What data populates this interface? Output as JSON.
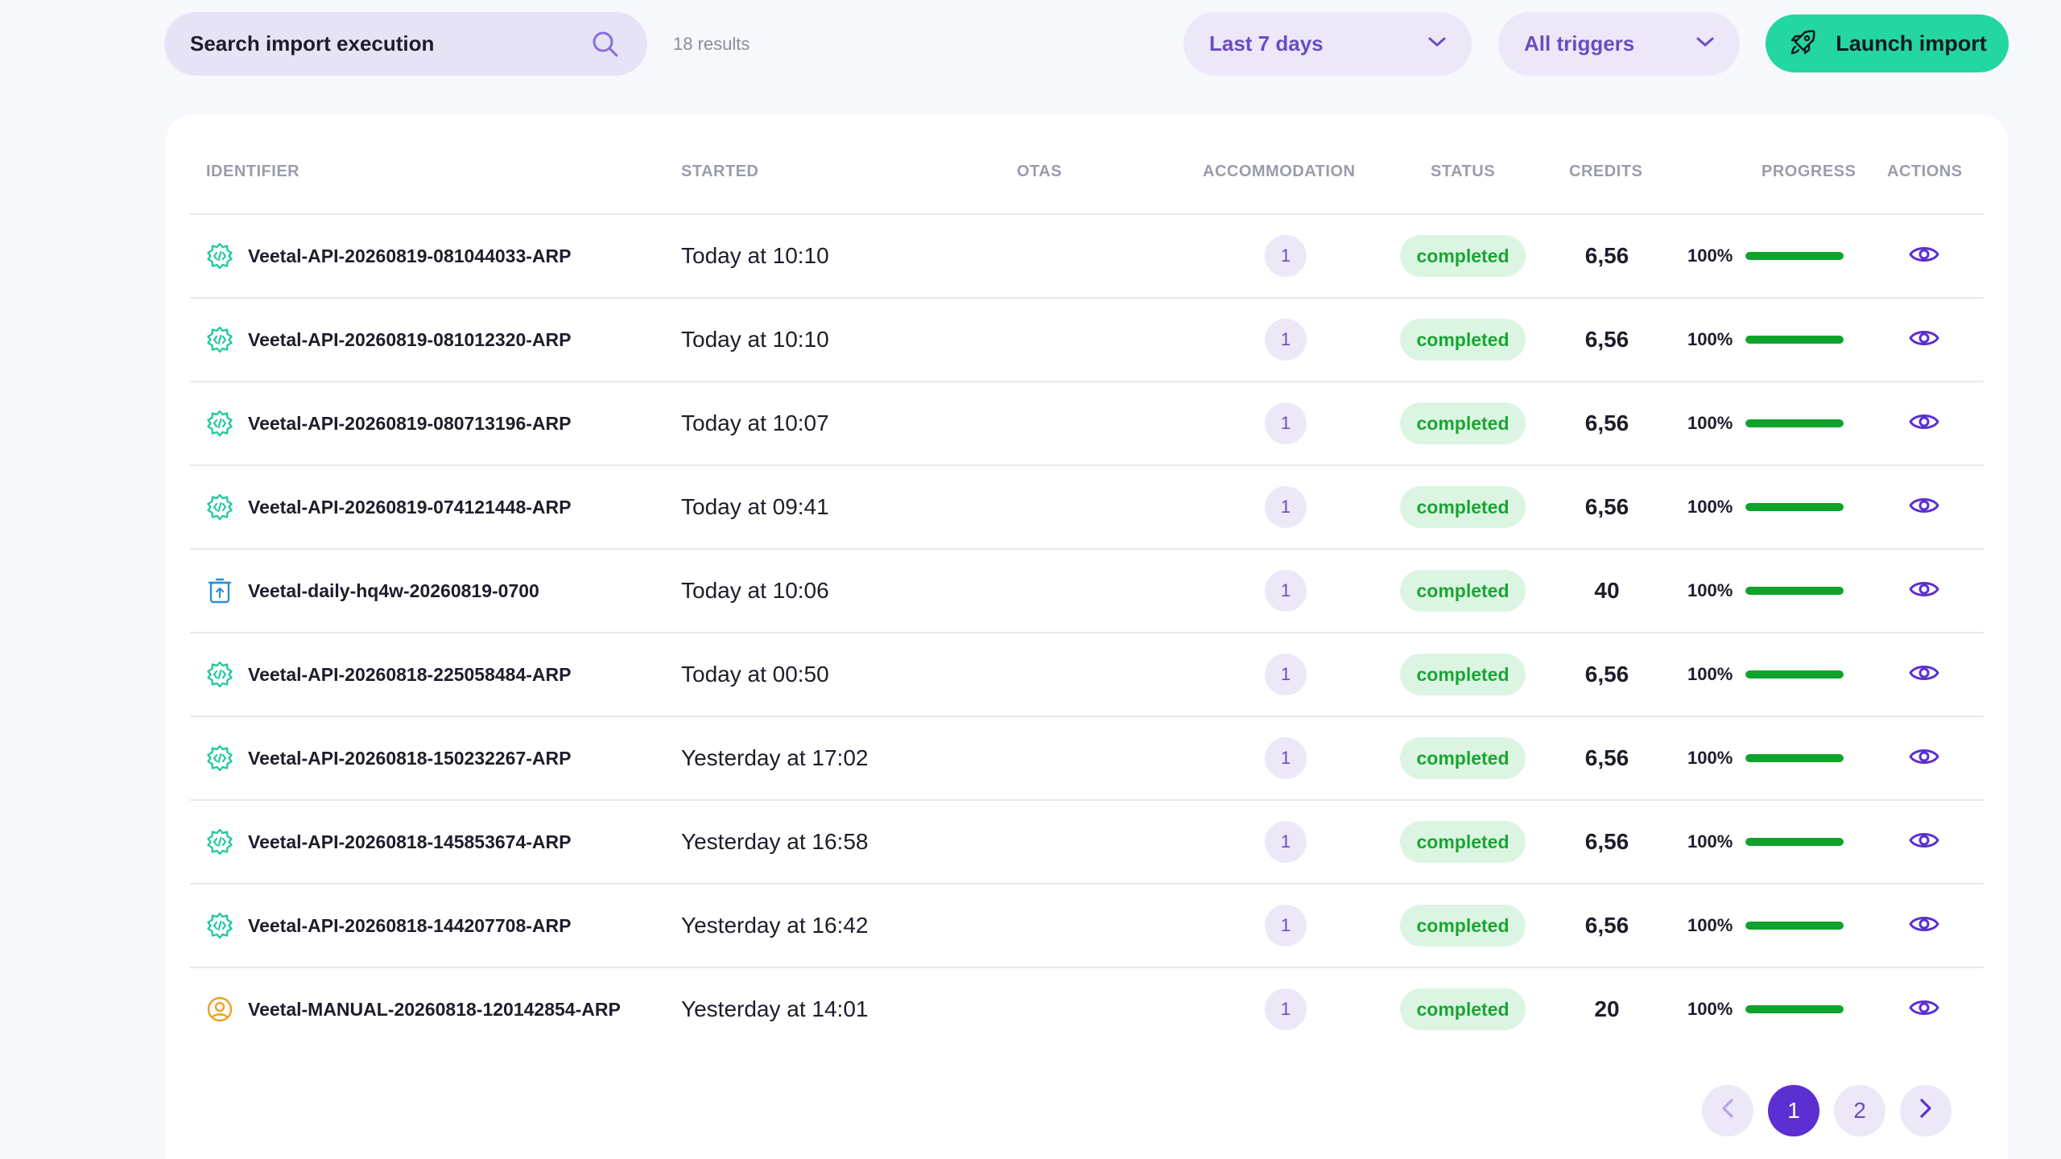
{
  "search": {
    "placeholder": "Search import execution"
  },
  "results_count": "18 results",
  "filters": {
    "period": "Last 7 days",
    "trigger": "All triggers"
  },
  "launch_button": "Launch import",
  "table": {
    "headers": {
      "identifier": "IDENTIFIER",
      "started": "STARTED",
      "otas": "OTAS",
      "accommodation": "ACCOMMODATION",
      "status": "STATUS",
      "credits": "CREDITS",
      "progress": "PROGRESS",
      "actions": "ACTIONS"
    },
    "rows": [
      {
        "icon": "api-gear-icon",
        "identifier": "Veetal-API-20260819-081044033-ARP",
        "started": "Today at 10:10",
        "accommodation": "1",
        "status": "completed",
        "credits": "6,56",
        "progress_label": "100%",
        "progress": 1.0
      },
      {
        "icon": "api-gear-icon",
        "identifier": "Veetal-API-20260819-081012320-ARP",
        "started": "Today at 10:10",
        "accommodation": "1",
        "status": "completed",
        "credits": "6,56",
        "progress_label": "100%",
        "progress": 1.0
      },
      {
        "icon": "api-gear-icon",
        "identifier": "Veetal-API-20260819-080713196-ARP",
        "started": "Today at 10:07",
        "accommodation": "1",
        "status": "completed",
        "credits": "6,56",
        "progress_label": "100%",
        "progress": 1.0
      },
      {
        "icon": "api-gear-icon",
        "identifier": "Veetal-API-20260819-074121448-ARP",
        "started": "Today at 09:41",
        "accommodation": "1",
        "status": "completed",
        "credits": "6,56",
        "progress_label": "100%",
        "progress": 1.0
      },
      {
        "icon": "scheduled-calendar-icon",
        "identifier": "Veetal-daily-hq4w-20260819-0700",
        "started": "Today at 10:06",
        "accommodation": "1",
        "status": "completed",
        "credits": "40",
        "progress_label": "100%",
        "progress": 1.0
      },
      {
        "icon": "api-gear-icon",
        "identifier": "Veetal-API-20260818-225058484-ARP",
        "started": "Today at 00:50",
        "accommodation": "1",
        "status": "completed",
        "credits": "6,56",
        "progress_label": "100%",
        "progress": 1.0
      },
      {
        "icon": "api-gear-icon",
        "identifier": "Veetal-API-20260818-150232267-ARP",
        "started": "Yesterday at 17:02",
        "accommodation": "1",
        "status": "completed",
        "credits": "6,56",
        "progress_label": "100%",
        "progress": 1.0
      },
      {
        "icon": "api-gear-icon",
        "identifier": "Veetal-API-20260818-145853674-ARP",
        "started": "Yesterday at 16:58",
        "accommodation": "1",
        "status": "completed",
        "credits": "6,56",
        "progress_label": "100%",
        "progress": 1.0
      },
      {
        "icon": "api-gear-icon",
        "identifier": "Veetal-API-20260818-144207708-ARP",
        "started": "Yesterday at 16:42",
        "accommodation": "1",
        "status": "completed",
        "credits": "6,56",
        "progress_label": "100%",
        "progress": 1.0
      },
      {
        "icon": "manual-user-icon",
        "identifier": "Veetal-MANUAL-20260818-120142854-ARP",
        "started": "Yesterday at 14:01",
        "accommodation": "1",
        "status": "completed",
        "credits": "20",
        "progress_label": "100%",
        "progress": 1.0
      }
    ]
  },
  "pagination": {
    "pages": [
      "1",
      "2"
    ],
    "current": "1"
  },
  "colors": {
    "accent": "#5b2fd1",
    "accent_text": "#6a4dc0",
    "launch_green": "#23d6a2",
    "status_green": "#18a631",
    "progress_green": "#0fa32b",
    "api_icon": "#23c9a0",
    "scheduled_icon": "#2a8fd6",
    "manual_icon": "#f0a020"
  }
}
